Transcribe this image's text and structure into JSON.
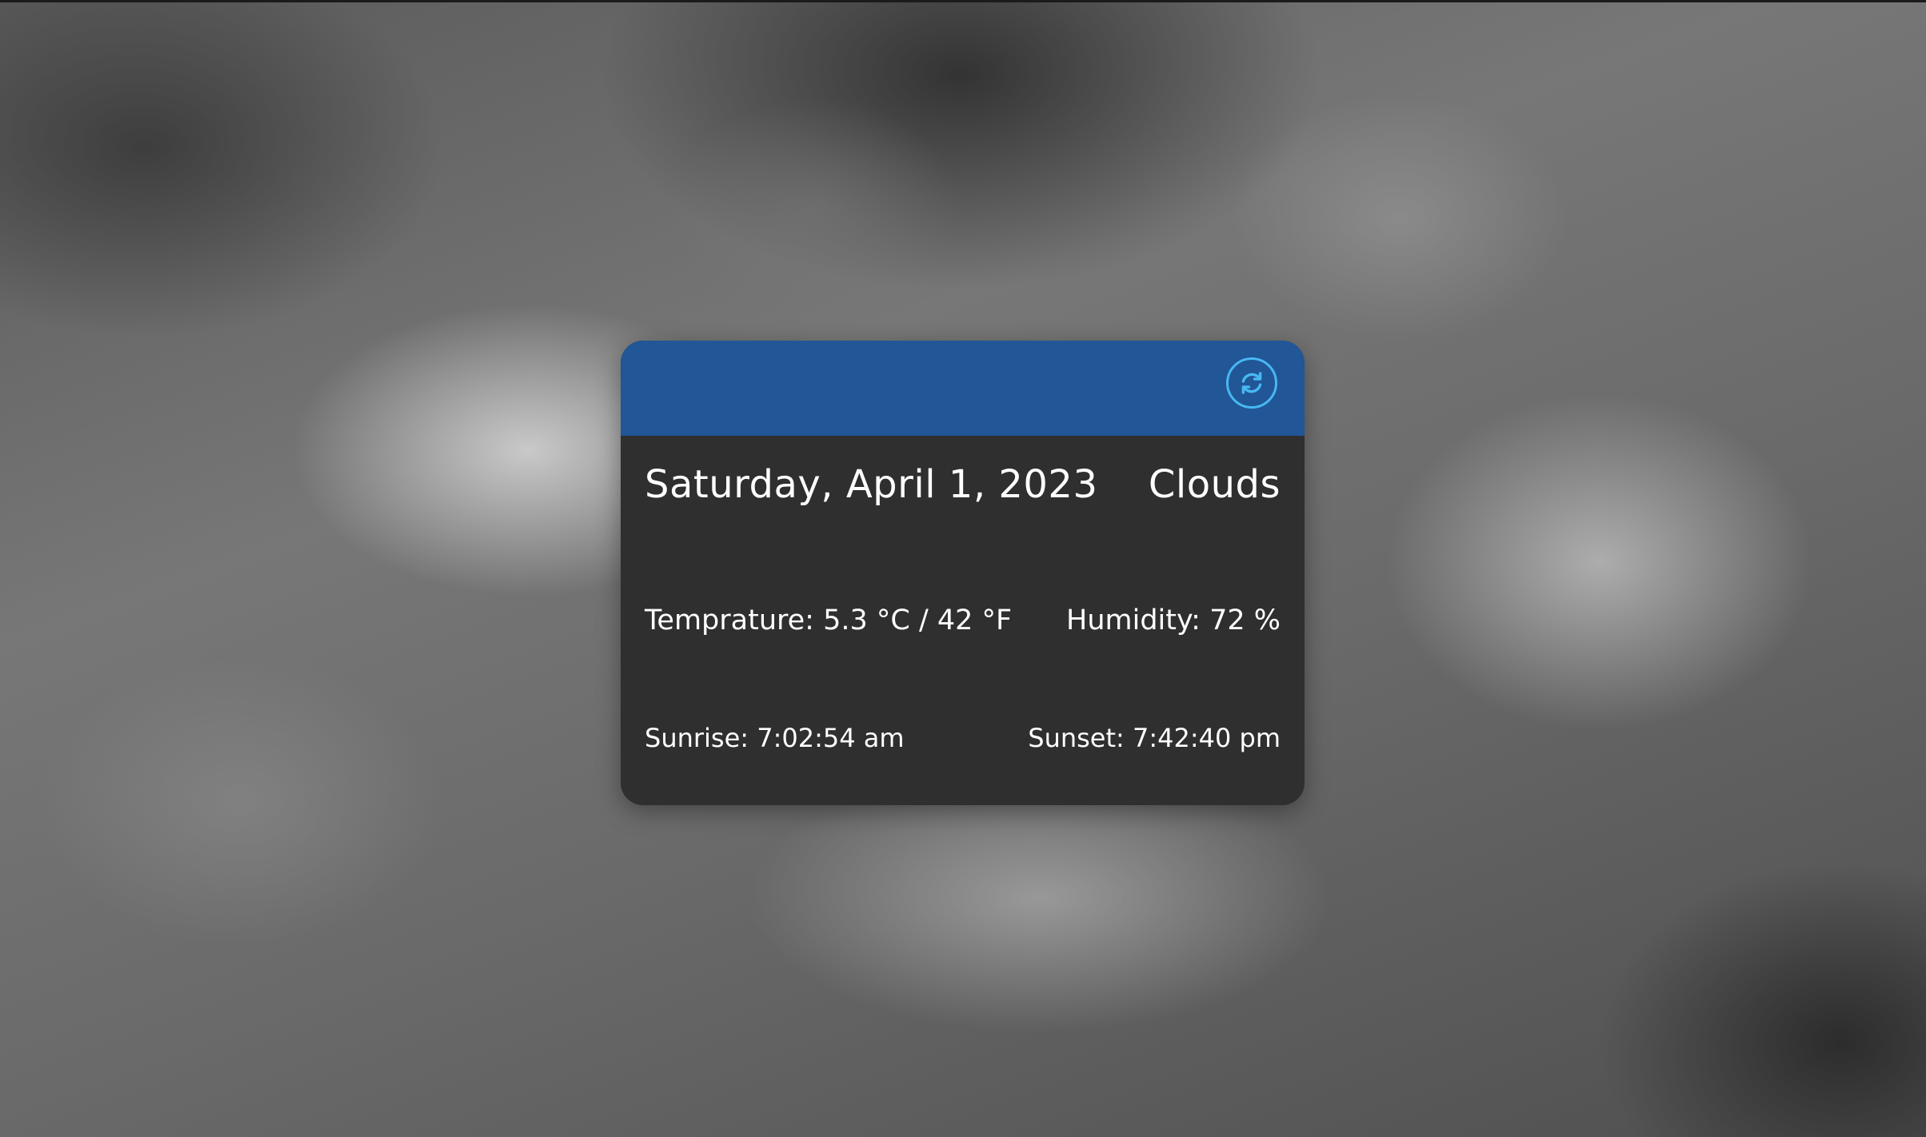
{
  "weather_card": {
    "date": "Saturday, April 1, 2023",
    "condition": "Clouds",
    "temperature": "Temprature: 5.3 °C / 42 °F",
    "humidity": "Humidity: 72 %",
    "sunrise": "Sunrise: 7:02:54 am",
    "sunset": "Sunset: 7:42:40 pm",
    "refresh_icon": "refresh-icon"
  },
  "colors": {
    "header": "#215697",
    "card_body": "#2f2f2f",
    "refresh_accent": "#47b8f2",
    "text": "#ffffff"
  }
}
